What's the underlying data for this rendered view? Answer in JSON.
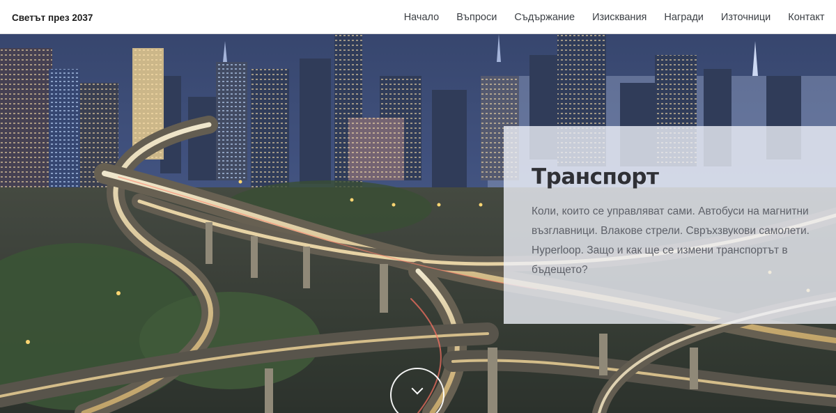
{
  "brand": {
    "title": "Светът през 2037"
  },
  "nav": {
    "items": [
      {
        "label": "Начало"
      },
      {
        "label": "Въпроси"
      },
      {
        "label": "Съдържание"
      },
      {
        "label": "Изисквания"
      },
      {
        "label": "Награди"
      },
      {
        "label": "Източници"
      },
      {
        "label": "Контакт"
      }
    ]
  },
  "hero": {
    "image_subject": "night-city-highway-interchange-photo"
  },
  "section": {
    "title": "Транспорт",
    "text": "Коли, които се управляват сами. Автобуси на магнитни възглавници. Влакове стрели. Свръхзвукови самолети. Hyperloop. Защо и как ще се измени транспортът в бъдещето?"
  },
  "scroll_indicator": {
    "icon": "chevron-down-icon"
  },
  "colors": {
    "nav_background": "#ffffff",
    "nav_text": "#3b3f44",
    "panel_background": "#eef0f7",
    "panel_title": "#2f3035",
    "panel_text": "#5d6068",
    "road_light": "#ffd98a"
  }
}
